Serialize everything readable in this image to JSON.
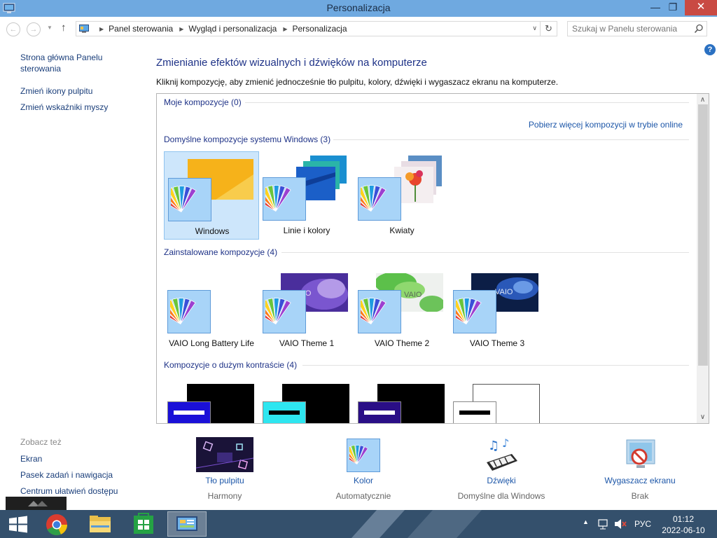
{
  "window": {
    "title": "Personalizacja"
  },
  "address": {
    "crumbs": [
      "Panel sterowania",
      "Wygląd i personalizacja",
      "Personalizacja"
    ],
    "search_placeholder": "Szukaj w Panelu sterowania"
  },
  "sidebar": {
    "home": "Strona główna Panelu sterowania",
    "links": [
      "Zmień ikony pulpitu",
      "Zmień wskaźniki myszy"
    ],
    "see_also_heading": "Zobacz też",
    "see_also": [
      "Ekran",
      "Pasek zadań i nawigacja",
      "Centrum ułatwień dostępu"
    ]
  },
  "main": {
    "title": "Zmienianie efektów wizualnych i dźwięków na komputerze",
    "description": "Kliknij kompozycję, aby zmienić jednocześnie tło pulpitu, kolory, dźwięki i wygaszacz ekranu na komputerze."
  },
  "themes": {
    "my_group": "Moje kompozycje (0)",
    "online_link": "Pobierz więcej kompozycji w trybie online",
    "default_group": "Domyślne kompozycje systemu Windows (3)",
    "default_items": [
      "Windows",
      "Linie i kolory",
      "Kwiaty"
    ],
    "installed_group": "Zainstalowane kompozycje (4)",
    "installed_items": [
      "VAIO Long Battery Life",
      "VAIO Theme 1",
      "VAIO Theme 2",
      "VAIO Theme 3"
    ],
    "installed_logo_text": "VAIO",
    "contrast_group": "Kompozycje o dużym kontraście (4)",
    "selected": "Windows"
  },
  "bottom": {
    "wallpaper": {
      "label": "Tło pulpitu",
      "value": "Harmony"
    },
    "color": {
      "label": "Kolor",
      "value": "Automatycznie"
    },
    "sounds": {
      "label": "Dźwięki",
      "value": "Domyślne dla Windows"
    },
    "screensaver": {
      "label": "Wygaszacz ekranu",
      "value": "Brak"
    }
  },
  "taskbar": {
    "apps": [
      "start-icon",
      "chrome-icon",
      "file-explorer-icon",
      "store-icon",
      "control-panel-icon"
    ],
    "language": "РУС",
    "time": "01:12",
    "date": "2022-06-10"
  },
  "colors": {
    "titlebar": "#6fa9e0",
    "link": "#1c56a8",
    "heading": "#1e3287",
    "taskbar": "#34506c",
    "close": "#c94a43"
  }
}
